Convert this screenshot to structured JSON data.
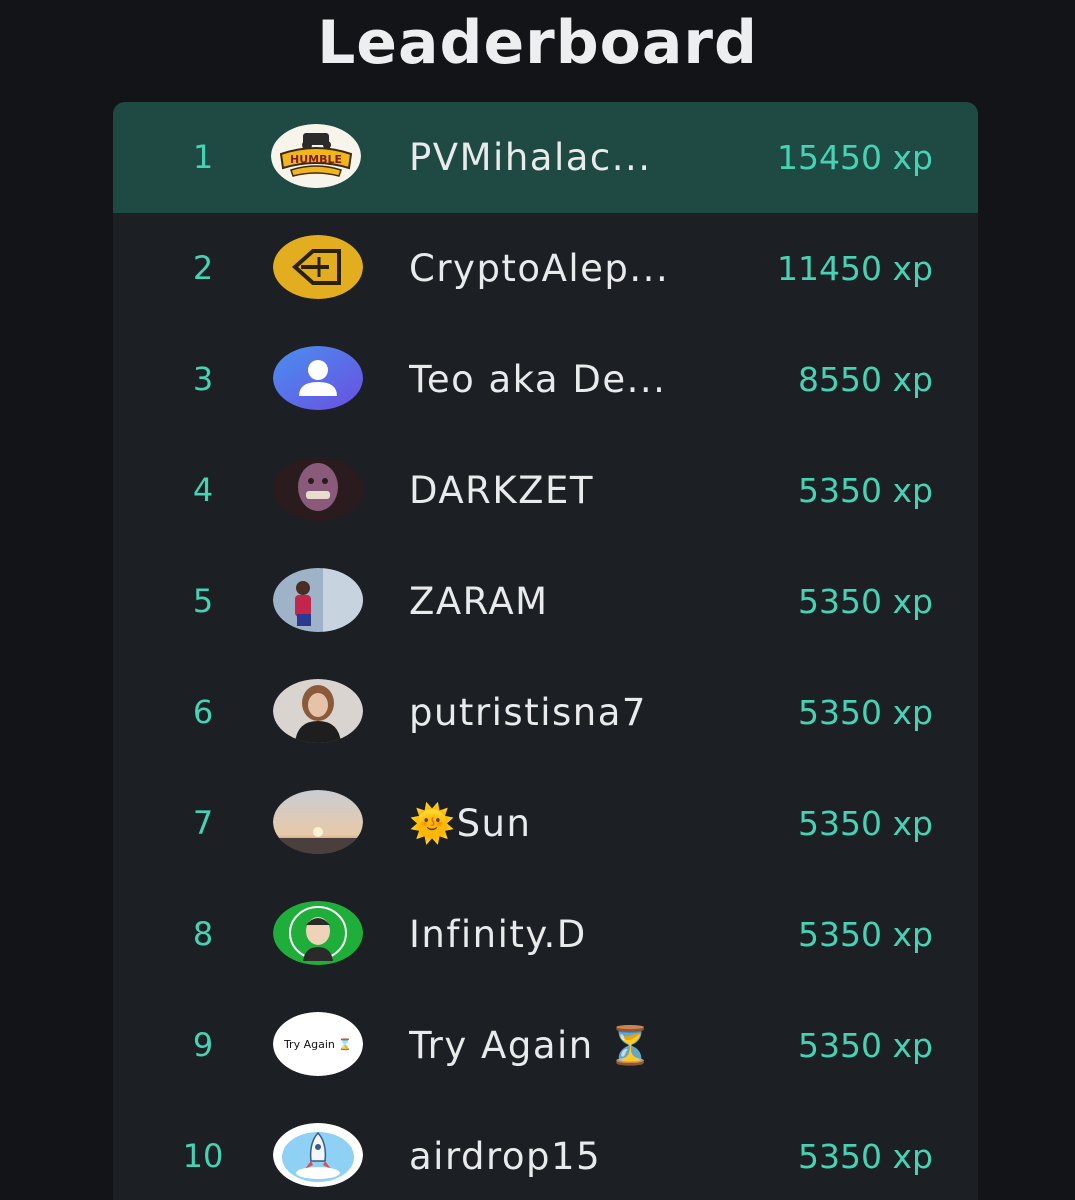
{
  "title": "Leaderboard",
  "colors": {
    "background": "#121417",
    "panel": "#1c1f23",
    "highlight_row": "#1f4a43",
    "accent": "#46d3b4",
    "text": "#e8eaec"
  },
  "rows": [
    {
      "rank": "1",
      "name": "PVMihalac...",
      "xp": "15450 xp",
      "avatar": "humble-tractors-logo"
    },
    {
      "rank": "2",
      "name": "CryptoAlep...",
      "xp": "11450 xp",
      "avatar": "yellow-arrow-logo"
    },
    {
      "rank": "3",
      "name": "Teo aka De...",
      "xp": "8550 xp",
      "avatar": "default-user-icon"
    },
    {
      "rank": "4",
      "name": "DARKZET",
      "xp": "5350 xp",
      "avatar": "purple-character-photo"
    },
    {
      "rank": "5",
      "name": "ZARAM",
      "xp": "5350 xp",
      "avatar": "person-photo"
    },
    {
      "rank": "6",
      "name": "putristisna7",
      "xp": "5350 xp",
      "avatar": "woman-photo"
    },
    {
      "rank": "7",
      "name": "🌞Sun",
      "xp": "5350 xp",
      "avatar": "sunset-photo"
    },
    {
      "rank": "8",
      "name": "Infinity.D",
      "xp": "5350 xp",
      "avatar": "green-cartoon-avatar"
    },
    {
      "rank": "9",
      "name": "Try Again ⏳",
      "xp": "5350 xp",
      "avatar": "try-again-text-avatar",
      "avatar_text": "Try Again ⌛"
    },
    {
      "rank": "10",
      "name": "airdrop15",
      "xp": "5350 xp",
      "avatar": "rocket-avatar"
    }
  ]
}
